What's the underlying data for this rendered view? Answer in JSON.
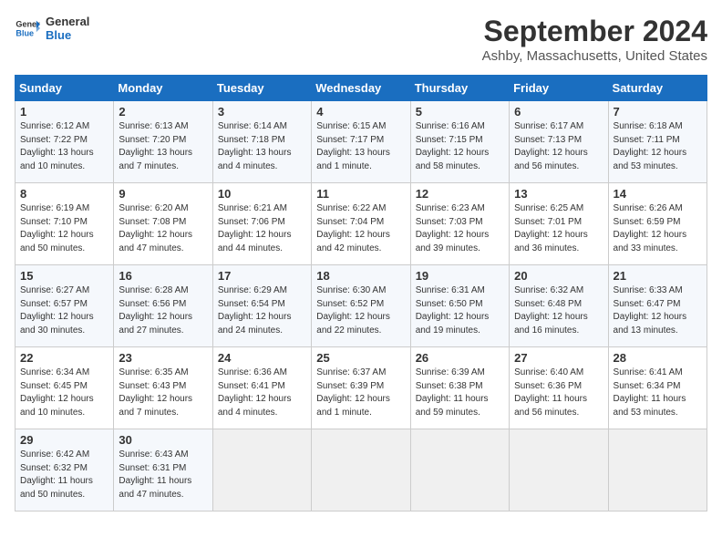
{
  "logo": {
    "line1": "General",
    "line2": "Blue"
  },
  "title": "September 2024",
  "location": "Ashby, Massachusetts, United States",
  "days_of_week": [
    "Sunday",
    "Monday",
    "Tuesday",
    "Wednesday",
    "Thursday",
    "Friday",
    "Saturday"
  ],
  "weeks": [
    [
      {
        "day": "1",
        "sunrise": "6:12 AM",
        "sunset": "7:22 PM",
        "daylight": "13 hours and 10 minutes."
      },
      {
        "day": "2",
        "sunrise": "6:13 AM",
        "sunset": "7:20 PM",
        "daylight": "13 hours and 7 minutes."
      },
      {
        "day": "3",
        "sunrise": "6:14 AM",
        "sunset": "7:18 PM",
        "daylight": "13 hours and 4 minutes."
      },
      {
        "day": "4",
        "sunrise": "6:15 AM",
        "sunset": "7:17 PM",
        "daylight": "13 hours and 1 minute."
      },
      {
        "day": "5",
        "sunrise": "6:16 AM",
        "sunset": "7:15 PM",
        "daylight": "12 hours and 58 minutes."
      },
      {
        "day": "6",
        "sunrise": "6:17 AM",
        "sunset": "7:13 PM",
        "daylight": "12 hours and 56 minutes."
      },
      {
        "day": "7",
        "sunrise": "6:18 AM",
        "sunset": "7:11 PM",
        "daylight": "12 hours and 53 minutes."
      }
    ],
    [
      {
        "day": "8",
        "sunrise": "6:19 AM",
        "sunset": "7:10 PM",
        "daylight": "12 hours and 50 minutes."
      },
      {
        "day": "9",
        "sunrise": "6:20 AM",
        "sunset": "7:08 PM",
        "daylight": "12 hours and 47 minutes."
      },
      {
        "day": "10",
        "sunrise": "6:21 AM",
        "sunset": "7:06 PM",
        "daylight": "12 hours and 44 minutes."
      },
      {
        "day": "11",
        "sunrise": "6:22 AM",
        "sunset": "7:04 PM",
        "daylight": "12 hours and 42 minutes."
      },
      {
        "day": "12",
        "sunrise": "6:23 AM",
        "sunset": "7:03 PM",
        "daylight": "12 hours and 39 minutes."
      },
      {
        "day": "13",
        "sunrise": "6:25 AM",
        "sunset": "7:01 PM",
        "daylight": "12 hours and 36 minutes."
      },
      {
        "day": "14",
        "sunrise": "6:26 AM",
        "sunset": "6:59 PM",
        "daylight": "12 hours and 33 minutes."
      }
    ],
    [
      {
        "day": "15",
        "sunrise": "6:27 AM",
        "sunset": "6:57 PM",
        "daylight": "12 hours and 30 minutes."
      },
      {
        "day": "16",
        "sunrise": "6:28 AM",
        "sunset": "6:56 PM",
        "daylight": "12 hours and 27 minutes."
      },
      {
        "day": "17",
        "sunrise": "6:29 AM",
        "sunset": "6:54 PM",
        "daylight": "12 hours and 24 minutes."
      },
      {
        "day": "18",
        "sunrise": "6:30 AM",
        "sunset": "6:52 PM",
        "daylight": "12 hours and 22 minutes."
      },
      {
        "day": "19",
        "sunrise": "6:31 AM",
        "sunset": "6:50 PM",
        "daylight": "12 hours and 19 minutes."
      },
      {
        "day": "20",
        "sunrise": "6:32 AM",
        "sunset": "6:48 PM",
        "daylight": "12 hours and 16 minutes."
      },
      {
        "day": "21",
        "sunrise": "6:33 AM",
        "sunset": "6:47 PM",
        "daylight": "12 hours and 13 minutes."
      }
    ],
    [
      {
        "day": "22",
        "sunrise": "6:34 AM",
        "sunset": "6:45 PM",
        "daylight": "12 hours and 10 minutes."
      },
      {
        "day": "23",
        "sunrise": "6:35 AM",
        "sunset": "6:43 PM",
        "daylight": "12 hours and 7 minutes."
      },
      {
        "day": "24",
        "sunrise": "6:36 AM",
        "sunset": "6:41 PM",
        "daylight": "12 hours and 4 minutes."
      },
      {
        "day": "25",
        "sunrise": "6:37 AM",
        "sunset": "6:39 PM",
        "daylight": "12 hours and 1 minute."
      },
      {
        "day": "26",
        "sunrise": "6:39 AM",
        "sunset": "6:38 PM",
        "daylight": "11 hours and 59 minutes."
      },
      {
        "day": "27",
        "sunrise": "6:40 AM",
        "sunset": "6:36 PM",
        "daylight": "11 hours and 56 minutes."
      },
      {
        "day": "28",
        "sunrise": "6:41 AM",
        "sunset": "6:34 PM",
        "daylight": "11 hours and 53 minutes."
      }
    ],
    [
      {
        "day": "29",
        "sunrise": "6:42 AM",
        "sunset": "6:32 PM",
        "daylight": "11 hours and 50 minutes."
      },
      {
        "day": "30",
        "sunrise": "6:43 AM",
        "sunset": "6:31 PM",
        "daylight": "11 hours and 47 minutes."
      },
      null,
      null,
      null,
      null,
      null
    ]
  ]
}
